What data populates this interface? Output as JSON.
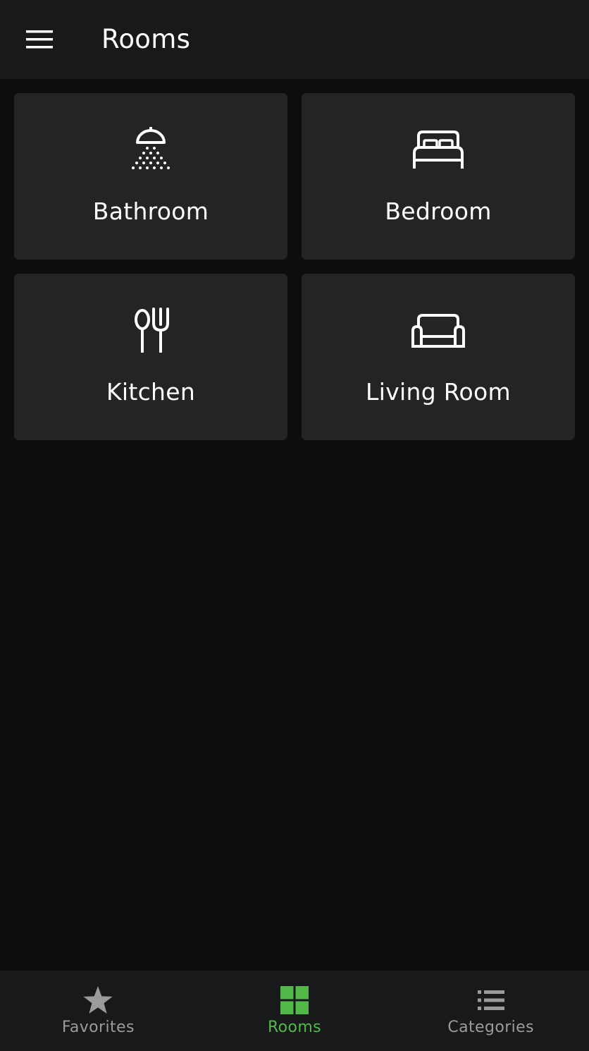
{
  "header": {
    "title": "Rooms",
    "menu_icon": "hamburger-menu-icon"
  },
  "rooms": [
    {
      "label": "Bathroom",
      "icon": "shower-icon"
    },
    {
      "label": "Bedroom",
      "icon": "bed-icon"
    },
    {
      "label": "Kitchen",
      "icon": "cutlery-icon"
    },
    {
      "label": "Living Room",
      "icon": "sofa-icon"
    }
  ],
  "bottom_nav": {
    "items": [
      {
        "label": "Favorites",
        "icon": "star-icon",
        "active": false
      },
      {
        "label": "Rooms",
        "icon": "grid-icon",
        "active": true
      },
      {
        "label": "Categories",
        "icon": "list-icon",
        "active": false
      }
    ],
    "active_color": "#52b848",
    "inactive_color": "#9a9b9d"
  },
  "colors": {
    "background": "#0c0d0f",
    "bar": "#18191b",
    "tile": "#232426",
    "accent": "#52b848"
  }
}
